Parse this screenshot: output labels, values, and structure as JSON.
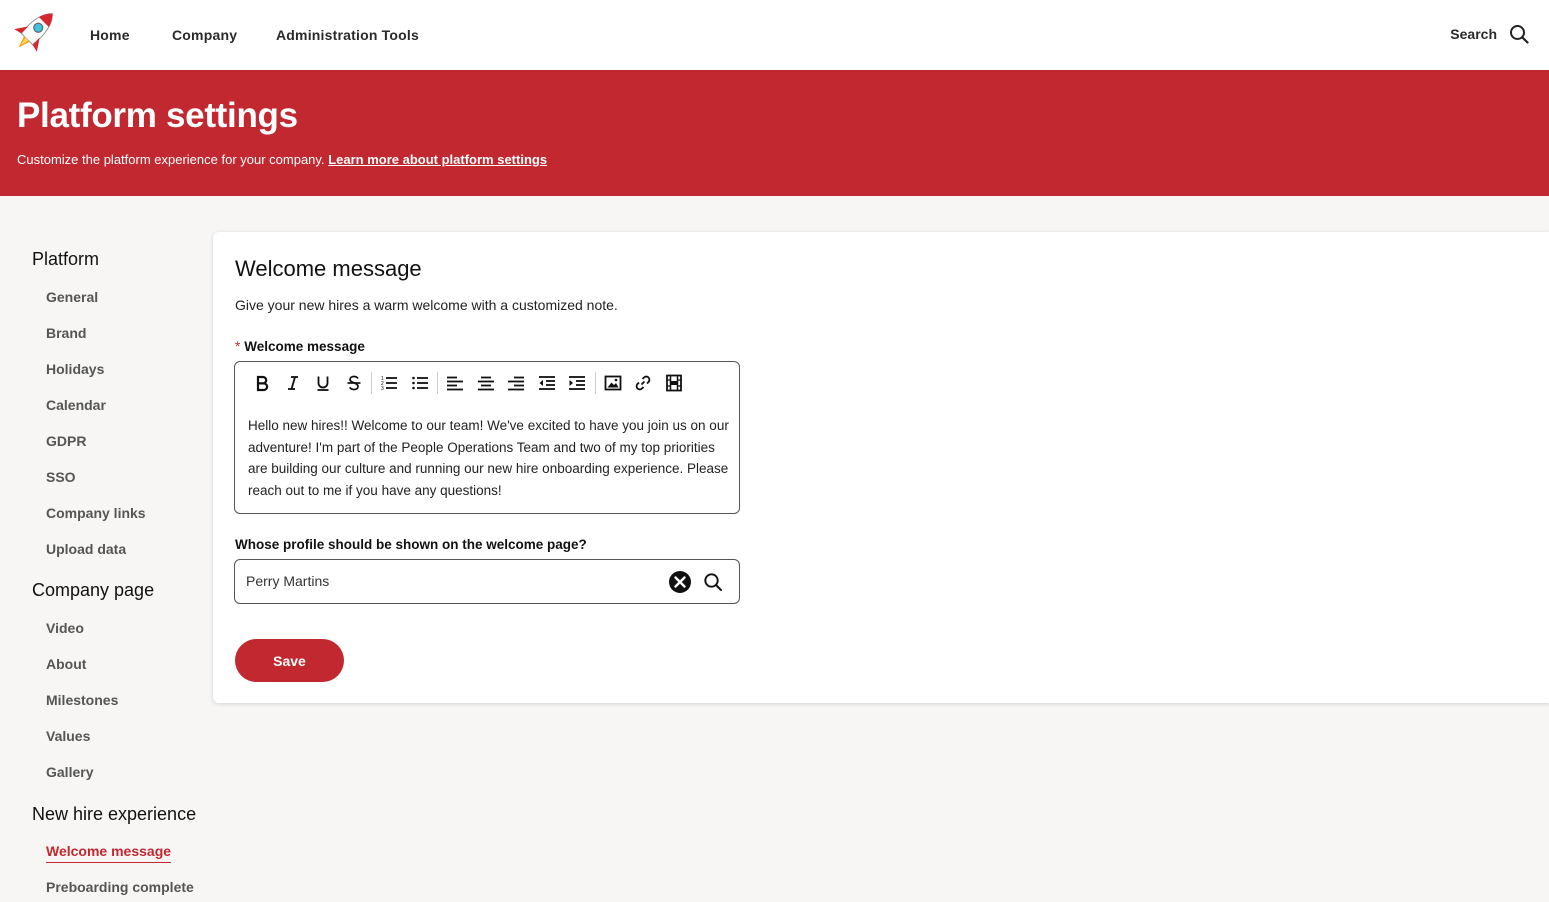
{
  "nav": {
    "links": [
      "Home",
      "Company",
      "Administration Tools"
    ],
    "search_label": "Search"
  },
  "banner": {
    "title": "Platform settings",
    "subtitle": "Customize the platform experience for your company.",
    "learn_more": "Learn more about platform settings"
  },
  "sidebar": {
    "sections": [
      {
        "title": "Platform",
        "items": [
          "General",
          "Brand",
          "Holidays",
          "Calendar",
          "GDPR",
          "SSO",
          "Company links",
          "Upload data"
        ]
      },
      {
        "title": "Company page",
        "items": [
          "Video",
          "About",
          "Milestones",
          "Values",
          "Gallery"
        ]
      },
      {
        "title": "New hire experience",
        "items": [
          "Welcome message",
          "Preboarding complete"
        ]
      }
    ],
    "active_item": "Welcome message"
  },
  "card": {
    "title": "Welcome message",
    "description": "Give your new hires a warm welcome with a customized note.",
    "message_label": "Welcome message",
    "required_marker": "*",
    "toolbar_icons": [
      "bold-icon",
      "italic-icon",
      "underline-icon",
      "strikethrough-icon",
      "ordered-list-icon",
      "bullet-list-icon",
      "align-left-icon",
      "align-center-icon",
      "align-right-icon",
      "outdent-icon",
      "indent-icon",
      "image-icon",
      "link-icon",
      "video-icon"
    ],
    "message_text": "Hello new hires!! Welcome to our team! We've excited to have you join us on our adventure! I'm part of the People Operations Team and two of my top priorities are building our culture and running our new hire onboarding experience. Please reach out to me if you have any questions!",
    "profile_label": "Whose profile should be shown on the welcome page?",
    "profile_value": "Perry Martins",
    "save_label": "Save"
  },
  "colors": {
    "brand": "#c12830",
    "background": "#f7f6f5"
  }
}
